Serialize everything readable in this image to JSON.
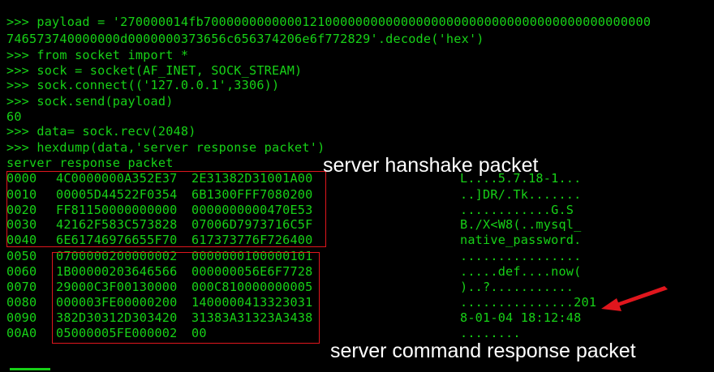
{
  "console": {
    "lines": [
      ">>> payload = '270000014fb70000000000001210000000000000000000000000000000000000000000",
      "746573740000000d0000000373656c656374206e6f772829'.decode('hex')",
      ">>> from socket import *",
      ">>> sock = socket(AF_INET, SOCK_STREAM)",
      ">>> sock.connect(('127.0.0.1',3306))",
      ">>> sock.send(payload)",
      "60",
      ">>> data= sock.recv(2048)",
      ">>> hexdump(data,'server response packet')",
      "server response packet"
    ]
  },
  "hexdump": {
    "rows": [
      {
        "offset": "0000",
        "hex1": "4C0000000A352E37",
        "hex2": "2E31382D31001A00",
        "ascii": "L....5.7.18-1..."
      },
      {
        "offset": "0010",
        "hex1": "00005D44522F0354",
        "hex2": "6B1300FFF7080200",
        "ascii": "..]DR/.Tk......."
      },
      {
        "offset": "0020",
        "hex1": "FF81150000000000",
        "hex2": "0000000000470E53",
        "ascii": "............G.S"
      },
      {
        "offset": "0030",
        "hex1": "42162F583C573828",
        "hex2": "07006D7973716C5F",
        "ascii": "B./X<W8(..mysql_"
      },
      {
        "offset": "0040",
        "hex1": "6E61746976655F70",
        "hex2": "617373776F726400",
        "ascii": "native_password."
      },
      {
        "offset": "0050",
        "hex1": "0700000200000002",
        "hex2": "0000000100000101",
        "ascii": "................"
      },
      {
        "offset": "0060",
        "hex1": "1B00000203646566",
        "hex2": "000000056E6F7728",
        "ascii": ".....def....now("
      },
      {
        "offset": "0070",
        "hex1": "29000C3F00130000",
        "hex2": "000C810000000005",
        "ascii": ")..?..........."
      },
      {
        "offset": "0080",
        "hex1": "000003FE00000200",
        "hex2": "1400000413323031",
        "ascii": "...............201"
      },
      {
        "offset": "0090",
        "hex1": "382D30312D303420",
        "hex2": "31383A31323A3438",
        "ascii": "8-01-04 18:12:48"
      },
      {
        "offset": "00A0",
        "hex1": "05000005FE000002",
        "hex2": "00",
        "ascii": "........"
      }
    ]
  },
  "annotations": {
    "handshake": "server hanshake packet",
    "command": "server command response packet"
  },
  "colors": {
    "terminal_text": "#17d117",
    "background": "#000000",
    "annotation_box": "#e0161d",
    "annotation_text": "#ffffff",
    "arrow": "#e0161d"
  }
}
